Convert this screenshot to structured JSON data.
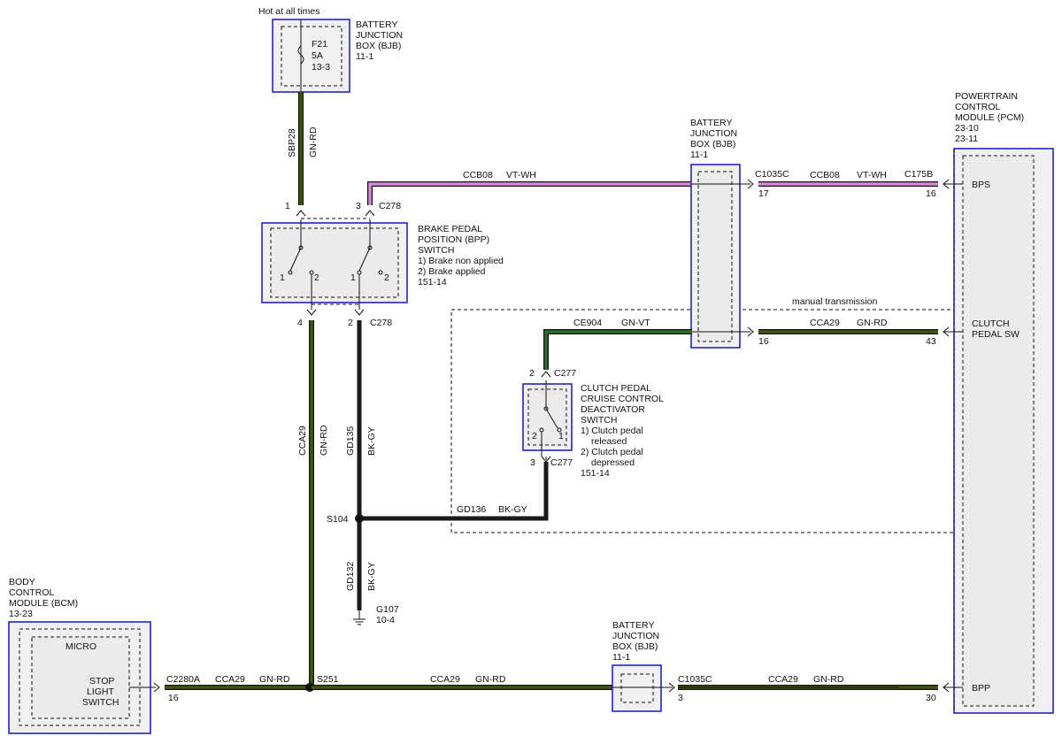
{
  "header": {
    "power_note": "Hot at all times"
  },
  "colors": {
    "gn_rd": "#3d5a0c",
    "vt_wh": "#d98ad9",
    "gn_vt": "#2f6e2a",
    "bk_gy": "#1a1a1a",
    "border_blue": "#2323c8"
  },
  "fuse": {
    "name": "F21",
    "rating": "5A",
    "ref": "13-3"
  },
  "bjb_top": {
    "line1": "BATTERY",
    "line2": "JUNCTION",
    "line3": "BOX (BJB)",
    "ref": "11-1"
  },
  "bjb_mid": {
    "line1": "BATTERY",
    "line2": "JUNCTION",
    "line3": "BOX (BJB)",
    "ref": "11-1"
  },
  "bjb_bottom": {
    "line1": "BATTERY",
    "line2": "JUNCTION",
    "line3": "BOX (BJB)",
    "ref": "11-1"
  },
  "pcm": {
    "line1": "POWERTRAIN",
    "line2": "CONTROL",
    "line3": "MODULE (PCM)",
    "ref1": "23-10",
    "ref2": "23-11",
    "pin_bps": "BPS",
    "pin_clutch1": "CLUTCH",
    "pin_clutch2": "PEDAL SW",
    "pin_bpp": "BPP"
  },
  "bpp_switch": {
    "line1": "BRAKE PEDAL",
    "line2": "POSITION (BPP)",
    "line3": "SWITCH",
    "state1": "1) Brake non applied",
    "state2": "2) Brake applied",
    "ref": "151-14",
    "c_top": "C278",
    "c_bottom": "C278",
    "pin_top_left": "1",
    "pin_top_right": "3",
    "pin_bottom_left": "4",
    "pin_bottom_right": "2",
    "pos_l1": "1",
    "pos_l2": "2",
    "pos_r1": "1",
    "pos_r2": "2"
  },
  "clutch_switch": {
    "line1": "CLUTCH PEDAL",
    "line2": "CRUISE CONTROL",
    "line3": "DEACTIVATOR",
    "line4": "SWITCH",
    "state1a": "1) Clutch pedal",
    "state1b": "released",
    "state2a": "2) Clutch pedal",
    "state2b": "depressed",
    "ref": "151-14",
    "c_top": "C277",
    "c_bottom": "C277",
    "pin_top": "2",
    "pin_bottom": "3",
    "pos1": "1",
    "pos2": "2"
  },
  "bcm": {
    "line1": "BODY",
    "line2": "CONTROL",
    "line3": "MODULE (BCM)",
    "ref": "13-23",
    "micro": "MICRO",
    "stop1": "STOP",
    "stop2": "LIGHT",
    "stop3": "SWITCH"
  },
  "manual_note": "manual transmission",
  "wires": {
    "sbp28": {
      "circuit": "SBP28",
      "color": "GN-RD"
    },
    "ccb08": {
      "circuit": "CCB08",
      "color": "VT-WH"
    },
    "ccb08_pcm": {
      "circuit": "CCB08",
      "color": "VT-WH"
    },
    "ce904": {
      "circuit": "CE904",
      "color": "GN-VT"
    },
    "cca29_pcm": {
      "circuit": "CCA29",
      "color": "GN-RD"
    },
    "cca29_vert": {
      "circuit": "CCA29",
      "color": "GN-RD"
    },
    "gd135": {
      "circuit": "GD135",
      "color": "BK-GY"
    },
    "gd136": {
      "circuit": "GD136",
      "color": "BK-GY"
    },
    "gd132": {
      "circuit": "GD132",
      "color": "BK-GY"
    },
    "cca29_bcm": {
      "circuit": "CCA29",
      "color": "GN-RD"
    },
    "cca29_bot_mid": {
      "circuit": "CCA29",
      "color": "GN-RD"
    },
    "cca29_bot_right": {
      "circuit": "CCA29",
      "color": "GN-RD"
    }
  },
  "connectors": {
    "c1035c_top": "C1035C",
    "c1035c_top_pin": "17",
    "c175b": "C175B",
    "c175b_pin": "16",
    "c1035c_mid_pin": "16",
    "pcm_clutch_pin": "43",
    "c2280a": "C2280A",
    "c2280a_pin": "16",
    "c1035c_bot": "C1035C",
    "c1035c_bot_pin": "3",
    "pcm_bpp_pin": "30"
  },
  "splices": {
    "s104": "S104",
    "s251": "S251"
  },
  "ground": {
    "name": "G107",
    "ref": "10-4"
  }
}
